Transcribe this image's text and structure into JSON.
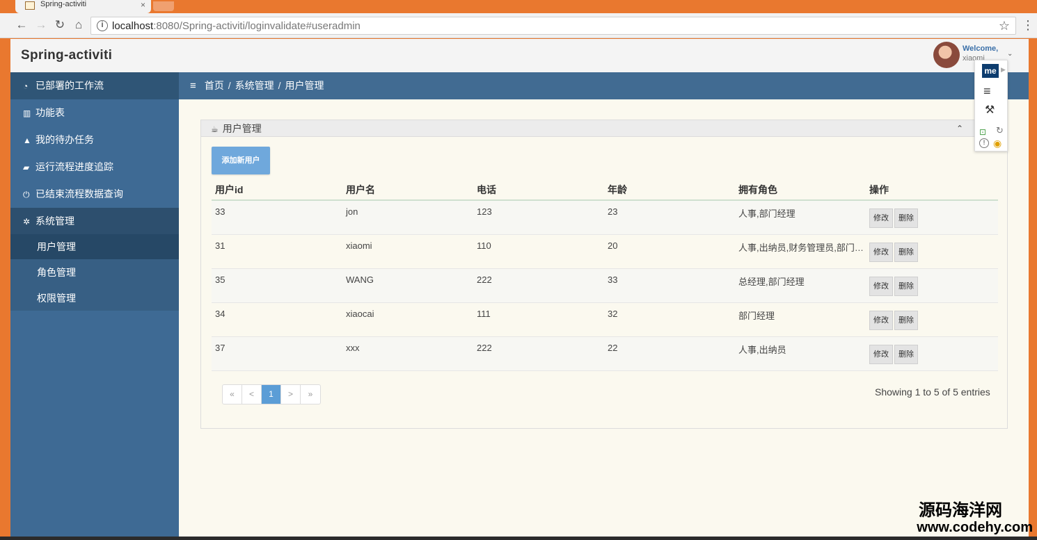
{
  "browser": {
    "tab_title": "Spring-activiti",
    "tab_close": "×",
    "back_glyph": "←",
    "forward_glyph": "→",
    "reload_glyph": "↻",
    "home_glyph": "⌂",
    "info_glyph": "i",
    "url_host": "localhost",
    "url_rest": ":8080/Spring-activiti/loginvalidate#useradmin",
    "star_glyph": "☆",
    "menu_glyph": "⋮"
  },
  "header": {
    "brand": "Spring-activiti",
    "welcome": "Welcome,",
    "username": "xiaomi",
    "caret": "⌄"
  },
  "sidebar": {
    "items": [
      {
        "icon": "◔",
        "label": "已部署的工作流"
      },
      {
        "icon": "▥",
        "label": "功能表"
      },
      {
        "icon": "▲",
        "label": "我的待办任务"
      },
      {
        "icon": "▰",
        "label": "运行流程进度追踪"
      },
      {
        "icon": "⏻",
        "label": "已结束流程数据查询"
      },
      {
        "icon": "✲",
        "label": "系统管理"
      }
    ],
    "sub_items": [
      {
        "label": "用户管理"
      },
      {
        "label": "角色管理"
      },
      {
        "label": "权限管理"
      }
    ]
  },
  "breadcrumb": {
    "menu_glyph": "≡",
    "home": "首页",
    "sep": "/",
    "section": "系统管理",
    "current": "用户管理"
  },
  "panel": {
    "cup_glyph": "☕",
    "title": "用户管理",
    "collapse_glyph": "⌃",
    "add_button": "添加新用户",
    "columns": [
      "用户id",
      "用户名",
      "电话",
      "年龄",
      "拥有角色",
      "操作"
    ],
    "rows": [
      {
        "id": "33",
        "name": "jon",
        "phone": "123",
        "age": "23",
        "roles": "人事,部门经理"
      },
      {
        "id": "31",
        "name": "xiaomi",
        "phone": "110",
        "age": "20",
        "roles": "人事,出纳员,财务管理员,部门经理"
      },
      {
        "id": "35",
        "name": "WANG",
        "phone": "222",
        "age": "33",
        "roles": "总经理,部门经理"
      },
      {
        "id": "34",
        "name": "xiaocai",
        "phone": "111",
        "age": "32",
        "roles": "部门经理"
      },
      {
        "id": "37",
        "name": "xxx",
        "phone": "222",
        "age": "22",
        "roles": "人事,出纳员"
      }
    ],
    "edit_label": "修改",
    "delete_label": "删除",
    "pager": {
      "first": "«",
      "prev": "<",
      "current": "1",
      "next": ">",
      "last": "»"
    },
    "entries_text": "Showing 1 to 5 of 5 entries"
  },
  "extension": {
    "logo": "me",
    "arrow": "▶",
    "menu_glyph": "≡",
    "wand_glyph": "⚒",
    "cast_glyph": "⊡",
    "refresh_glyph": "↻",
    "alert_glyph": "!",
    "eye_glyph": "◉"
  },
  "watermark": {
    "cn": "源码海洋网",
    "url": "www.codehy.com"
  }
}
